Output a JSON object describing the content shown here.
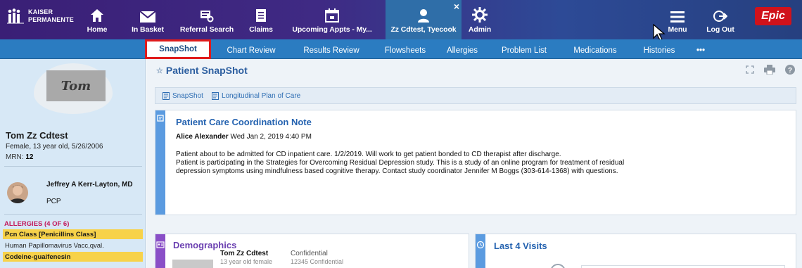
{
  "toolbar": {
    "logo_line1": "KAISER",
    "logo_line2": "PERMANENTE",
    "items": [
      {
        "label": "Home",
        "icon": "home-icon"
      },
      {
        "label": "In Basket",
        "icon": "envelope-icon"
      },
      {
        "label": "Referral Search",
        "icon": "referral-icon"
      },
      {
        "label": "Claims",
        "icon": "document-icon"
      },
      {
        "label": "Upcoming Appts - My...",
        "icon": "calendar-icon"
      },
      {
        "label": "Zz Cdtest, Tyecook",
        "icon": "person-icon"
      },
      {
        "label": "Admin",
        "icon": "gear-icon"
      },
      {
        "label": "Menu",
        "icon": "menu-icon"
      },
      {
        "label": "Log Out",
        "icon": "logout-icon"
      }
    ],
    "close_glyph": "×",
    "brand": "Epic"
  },
  "tabs": [
    {
      "label": "SnapShot",
      "active": true
    },
    {
      "label": "Chart Review"
    },
    {
      "label": "Results Review"
    },
    {
      "label": "Flowsheets"
    },
    {
      "label": "Allergies"
    },
    {
      "label": "Problem List"
    },
    {
      "label": "Medications"
    },
    {
      "label": "Histories"
    },
    {
      "label": "•••"
    }
  ],
  "patient": {
    "signature_text": "Tom",
    "name": "Tom Zz Cdtest",
    "demographics": "Female, 13 year old, 5/26/2006",
    "mrn_label": "MRN:",
    "mrn_value": "12",
    "pcp_name": "Jeffrey A Kerr-Layton, MD",
    "pcp_role": "PCP",
    "allergies_header": "ALLERGIES (4 OF 6)",
    "allergies": [
      {
        "label": "Pcn Class [Penicillins Class]",
        "highlight": true
      },
      {
        "label": "Human Papillomavirus Vacc,qval.",
        "highlight": false
      },
      {
        "label": "Codeine-guaifenesin",
        "highlight": true
      }
    ]
  },
  "main": {
    "page_title": "Patient SnapShot",
    "subnav": [
      "SnapShot",
      "Longitudinal Plan of Care"
    ],
    "note": {
      "title": "Patient Care Coordination Note",
      "author": "Alice Alexander",
      "datetime": "Wed Jan 2, 2019 4:40 PM",
      "line1": "Patient about to be admitted for CD inpatient care.  1/2/2019.  Will work to get patient bonded to CD therapist after discharge.",
      "line2": "Patient is participating in the Strategies for Overcoming Residual Depression study.  This is a study of an online program for treatment of residual",
      "line3": "depression symptoms using mindfulness based cognitive therapy.  Contact study coordinator Jennifer M Boggs (303-614-1368) with questions."
    },
    "demographics_card": {
      "title": "Demographics",
      "name": "Tom Zz Cdtest",
      "sub": "13 year old female",
      "confidential": "Confidential",
      "conf_sub": "12345 Confidential"
    },
    "visits_card": {
      "title": "Last 4 Visits"
    }
  },
  "colors": {
    "toolbar": "#3a1f76",
    "tabbar": "#2b7cc1",
    "active_tab_outline": "#e01c1c",
    "allergy_highlight": "#f7d24a",
    "allergy_header": "#c2185b",
    "title_blue": "#2563b0",
    "epic_red": "#d0121b"
  }
}
